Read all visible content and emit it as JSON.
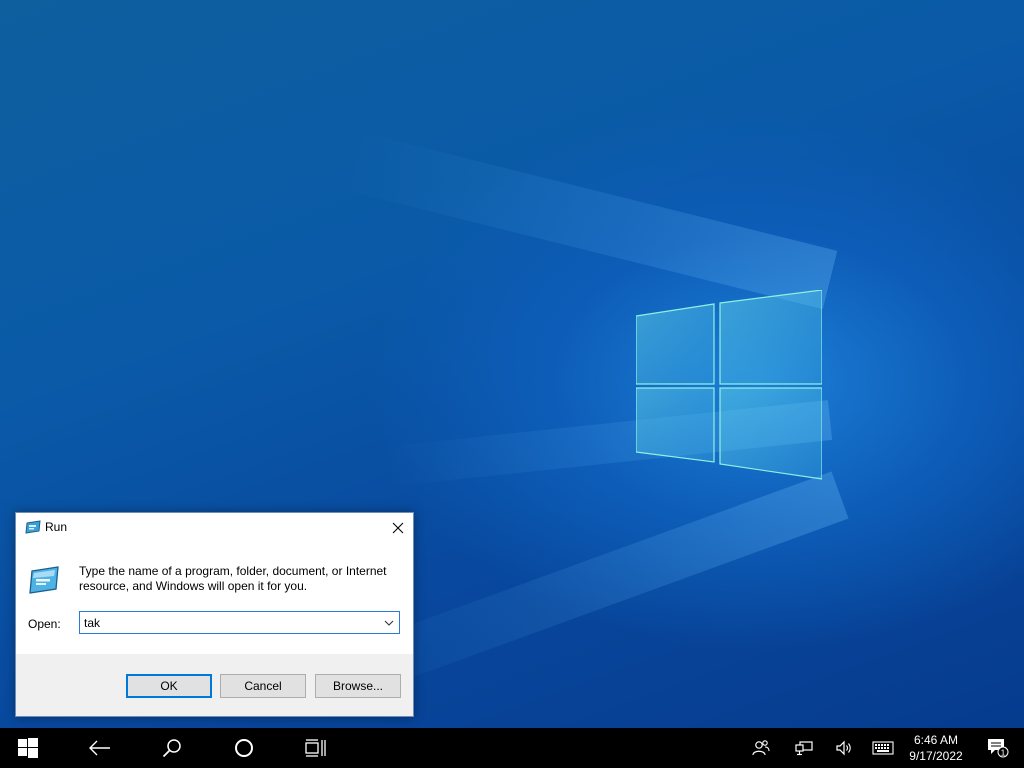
{
  "desktop": {
    "wallpaper": "windows-10-default",
    "accent_color": "#0078d7"
  },
  "run_dialog": {
    "title": "Run",
    "title_icon": "run-icon",
    "close_icon": "close-icon",
    "description": "Type the name of a program, folder, document, or Internet resource, and Windows will open it for you.",
    "open_label": "Open:",
    "open_value": "tak",
    "buttons": {
      "ok": "OK",
      "cancel": "Cancel",
      "browse": "Browse..."
    }
  },
  "taskbar": {
    "icons": [
      "start-icon",
      "back-icon",
      "search-icon",
      "cortana-icon",
      "task-view-icon"
    ],
    "tray_icons": [
      "people-icon",
      "network-icon",
      "volume-icon",
      "keyboard-icon"
    ],
    "time": "6:46 AM",
    "date": "9/17/2022",
    "notification_count": "1"
  }
}
